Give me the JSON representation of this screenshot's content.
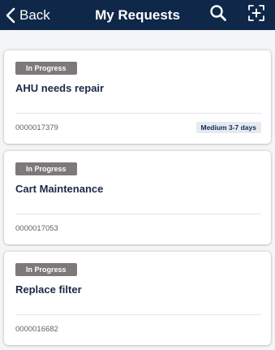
{
  "header": {
    "back_label": "Back",
    "title": "My Requests"
  },
  "icons": {
    "back": "chevron-left-icon",
    "search": "search-icon",
    "add": "add-request-icon"
  },
  "colors": {
    "header_bg": "#0f2748",
    "status_badge_bg": "#7d7879",
    "priority_badge_bg": "#e3ebf2",
    "list_bg": "#f4f5f7"
  },
  "requests": [
    {
      "status": "In Progress",
      "title": "AHU needs repair",
      "number": "0000017379",
      "priority": "Medium 3-7 days"
    },
    {
      "status": "In Progress",
      "title": "Cart Maintenance",
      "number": "0000017053"
    },
    {
      "status": "In Progress",
      "title": "Replace filter",
      "number": "0000016682"
    }
  ]
}
